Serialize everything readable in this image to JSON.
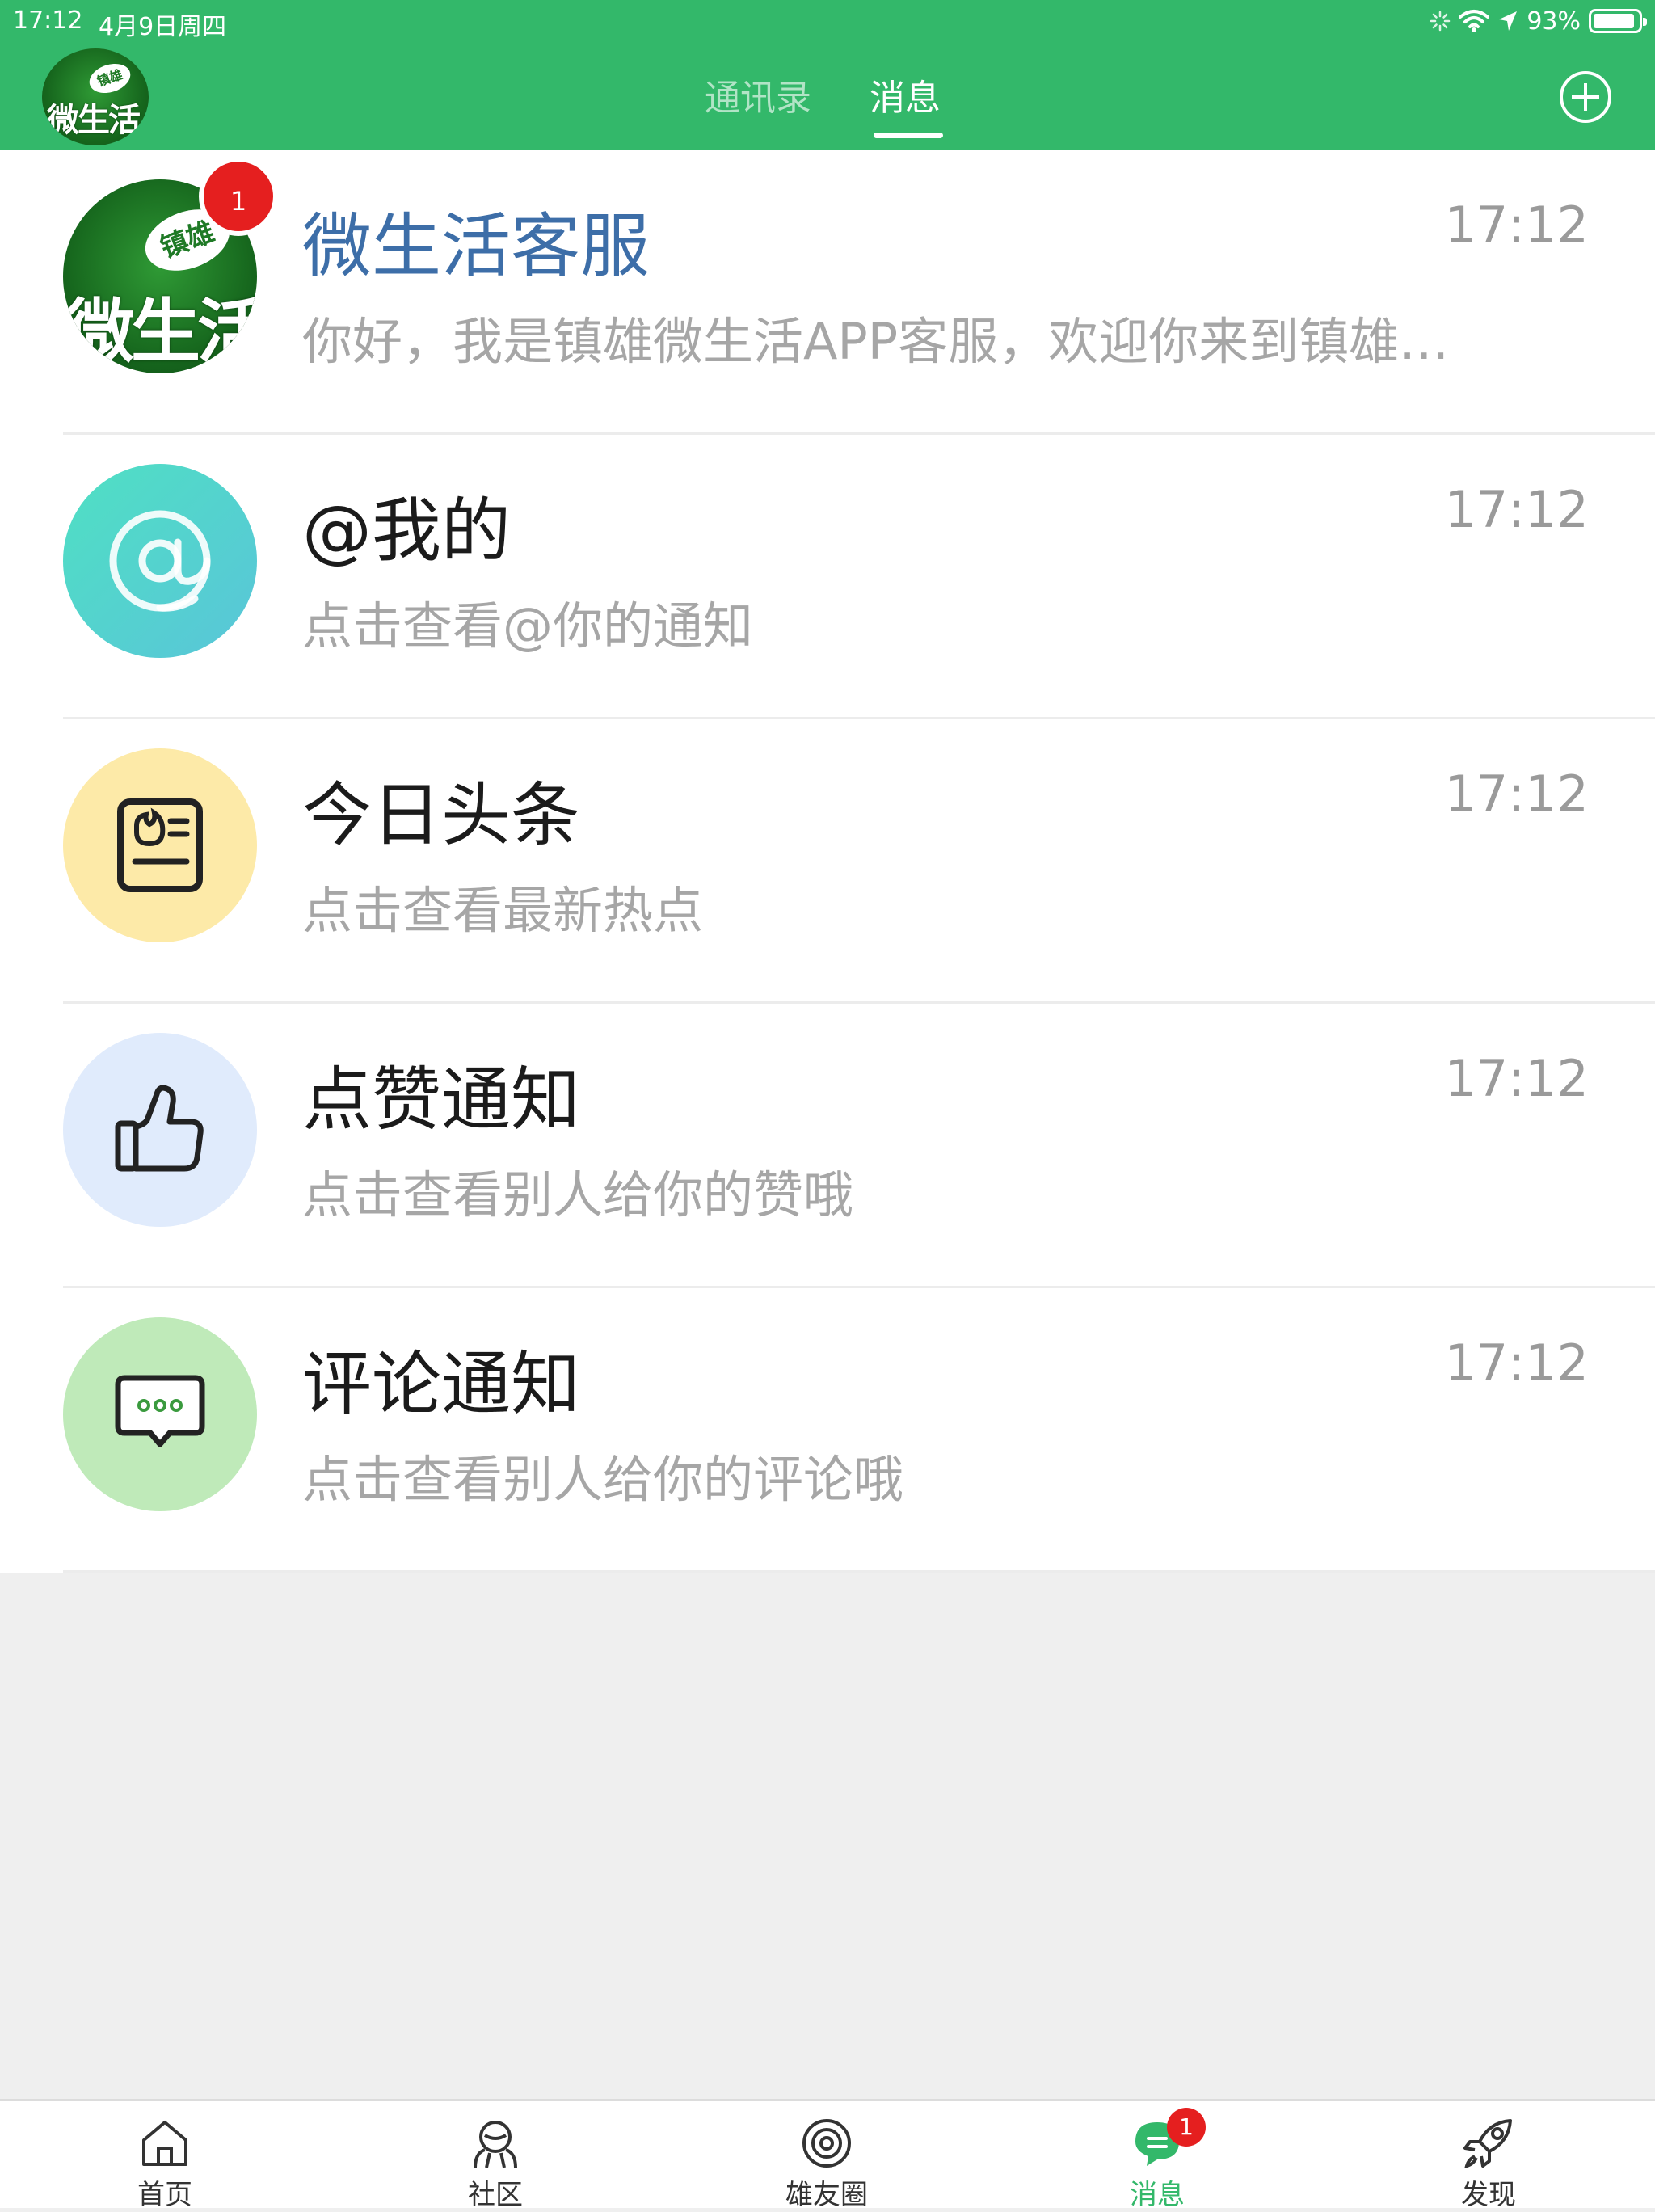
{
  "status_bar": {
    "time": "17:12",
    "date": "4月9日周四",
    "battery": "93%",
    "battery_level": 0.93
  },
  "header": {
    "logo_text": "微生活",
    "logo_badge": "镇雄",
    "tabs": [
      {
        "label": "通讯录",
        "active": false
      },
      {
        "label": "消息",
        "active": true
      }
    ],
    "add_icon": "plus-circle-icon",
    "colors": {
      "primary": "#33b86a"
    }
  },
  "messages": [
    {
      "title": "微生活客服",
      "subtitle": "你好，我是镇雄微生活APP客服，欢迎你来到镇雄微生活！",
      "time": "17:12",
      "badge": "1",
      "avatar_text": "微生活",
      "avatar_badge": "镇雄"
    },
    {
      "title": "@我的",
      "subtitle": "点击查看@你的通知",
      "time": "17:12",
      "icon": "at-icon"
    },
    {
      "title": "今日头条",
      "subtitle": "点击查看最新热点",
      "time": "17:12",
      "icon": "news-icon"
    },
    {
      "title": "点赞通知",
      "subtitle": "点击查看别人给你的赞哦",
      "time": "17:12",
      "icon": "thumbs-up-icon"
    },
    {
      "title": "评论通知",
      "subtitle": "点击查看别人给你的评论哦",
      "time": "17:12",
      "icon": "comment-icon"
    }
  ],
  "tabbar": {
    "items": [
      {
        "label": "首页",
        "icon": "home-icon"
      },
      {
        "label": "社区",
        "icon": "community-icon"
      },
      {
        "label": "雄友圈",
        "icon": "circle-icon"
      },
      {
        "label": "消息",
        "icon": "message-icon",
        "badge": "1",
        "active": true
      },
      {
        "label": "发现",
        "icon": "rocket-icon"
      }
    ]
  }
}
